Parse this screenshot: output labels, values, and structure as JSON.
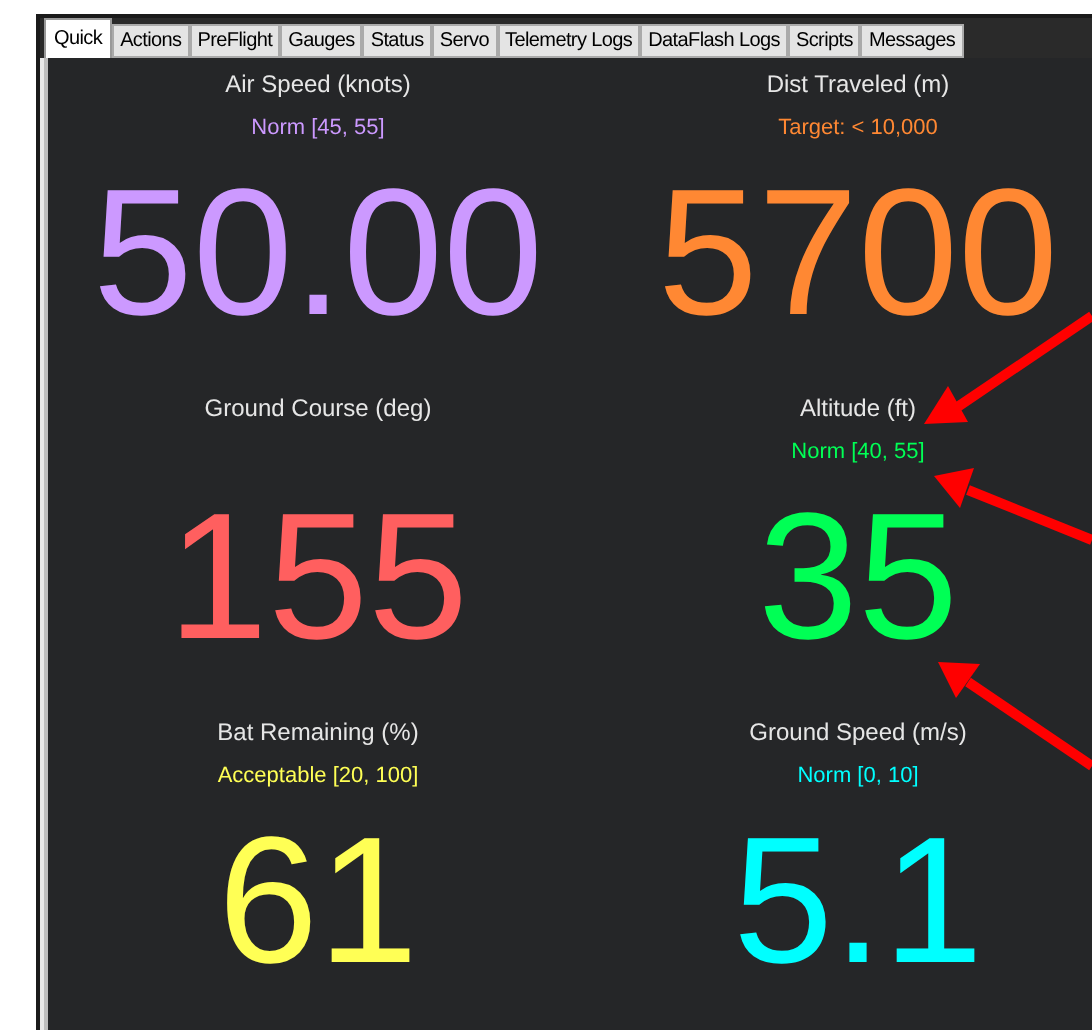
{
  "tabs": [
    {
      "label": "Quick",
      "selected": true
    },
    {
      "label": "Actions",
      "selected": false
    },
    {
      "label": "PreFlight",
      "selected": false
    },
    {
      "label": "Gauges",
      "selected": false
    },
    {
      "label": "Status",
      "selected": false
    },
    {
      "label": "Servo",
      "selected": false
    },
    {
      "label": "Telemetry Logs",
      "selected": false
    },
    {
      "label": "DataFlash Logs",
      "selected": false
    },
    {
      "label": "Scripts",
      "selected": false
    },
    {
      "label": "Messages",
      "selected": false
    }
  ],
  "readouts": [
    {
      "label": "Air Speed (knots)",
      "range": "Norm [45, 55]",
      "value": "50.00",
      "color": "#cc99ff"
    },
    {
      "label": "Dist Traveled (m)",
      "range": "Target: < 10,000",
      "value": "5700",
      "color": "#ff8833"
    },
    {
      "label": "Ground Course (deg)",
      "value": "155",
      "color": "#ff5f5f"
    },
    {
      "label": "Altitude (ft)",
      "range": "Norm [40, 55]",
      "value": "35",
      "color": "#00ff55"
    },
    {
      "label": "Bat Remaining (%)",
      "range": "Acceptable [20, 100]",
      "value": "61",
      "color": "#ffff55"
    },
    {
      "label": "Ground Speed (m/s)",
      "range": "Norm [0, 10]",
      "value": "5.1",
      "color": "#00ffff"
    }
  ]
}
